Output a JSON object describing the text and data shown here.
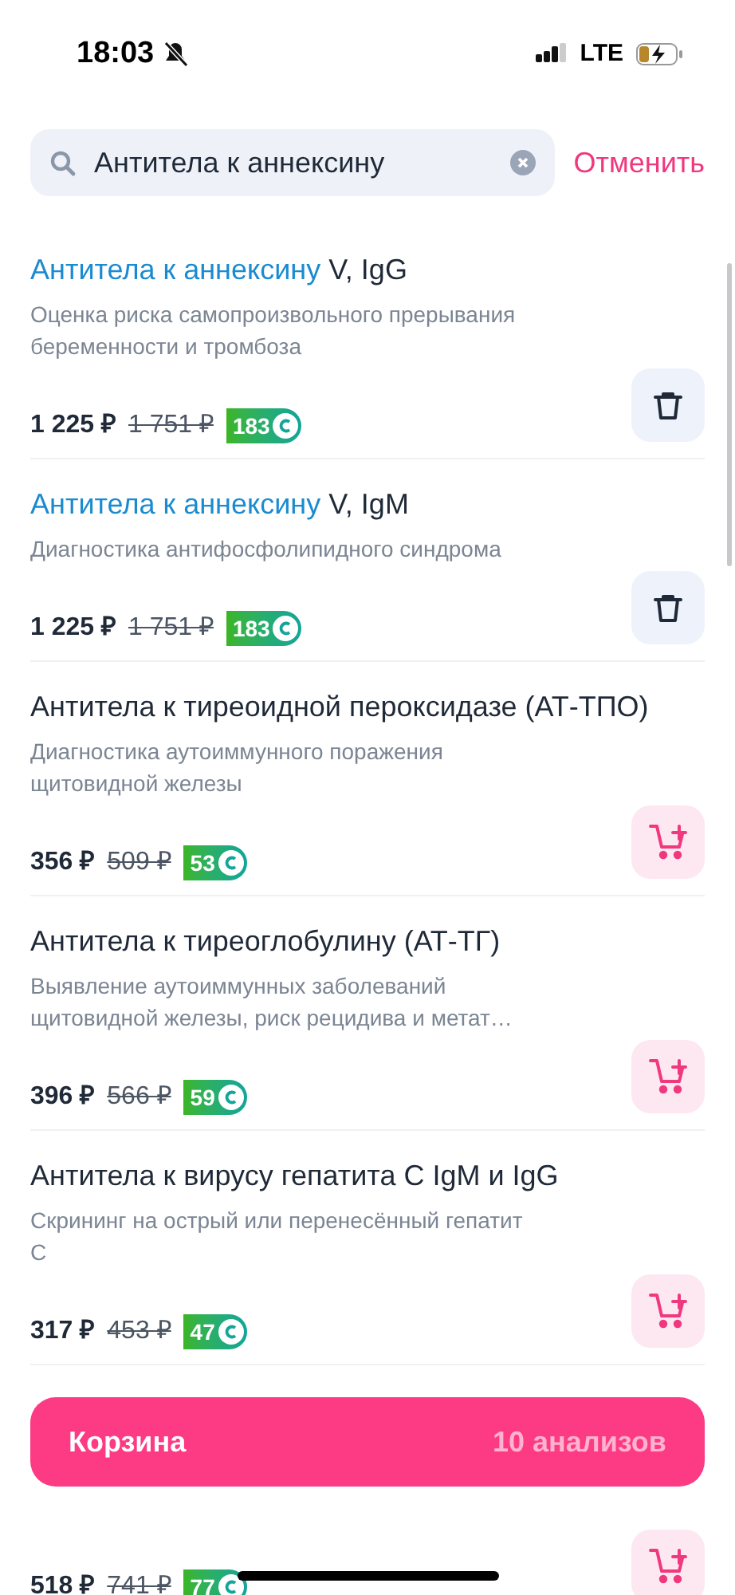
{
  "status_bar": {
    "time": "18:03",
    "network": "LTE"
  },
  "search": {
    "value": "Антитела к аннексину",
    "cancel": "Отменить"
  },
  "items": [
    {
      "title_match": "Антитела к аннексину",
      "title_rest": " V, IgG",
      "description": "Оценка риска самопроизвольного прерывания беременности и тромбоза",
      "price": "1 225 ₽",
      "old_price": "1 751 ₽",
      "bonus": "183",
      "in_cart": true
    },
    {
      "title_match": "Антитела к аннексину",
      "title_rest": " V, IgM",
      "description": "Диагностика антифосфолипидного синдрома",
      "price": "1 225 ₽",
      "old_price": "1 751 ₽",
      "bonus": "183",
      "in_cart": true
    },
    {
      "title_rest": "Антитела к тиреоидной пероксидазе (АТ-ТПО)",
      "description": "Диагностика аутоиммунного поражения щитовидной железы",
      "price": "356 ₽",
      "old_price": "509 ₽",
      "bonus": "53",
      "in_cart": false
    },
    {
      "title_rest": "Антитела к тиреоглобулину (АТ-ТГ)",
      "description": "Выявление аутоиммунных заболеваний щитовидной железы, риск рецидива и метат…",
      "price": "396 ₽",
      "old_price": "566 ₽",
      "bonus": "59",
      "in_cart": false
    },
    {
      "title_rest": "Антитела к вирусу гепатита С IgM и IgG",
      "description": "Скрининг на острый или перенесённый гепатит С",
      "price": "317 ₽",
      "old_price": "453 ₽",
      "bonus": "47",
      "in_cart": false
    },
    {
      "price": "518 ₽",
      "old_price": "741 ₽",
      "bonus": "77",
      "in_cart": false
    }
  ],
  "cart_bar": {
    "label": "Корзина",
    "count": "10 анализов"
  }
}
